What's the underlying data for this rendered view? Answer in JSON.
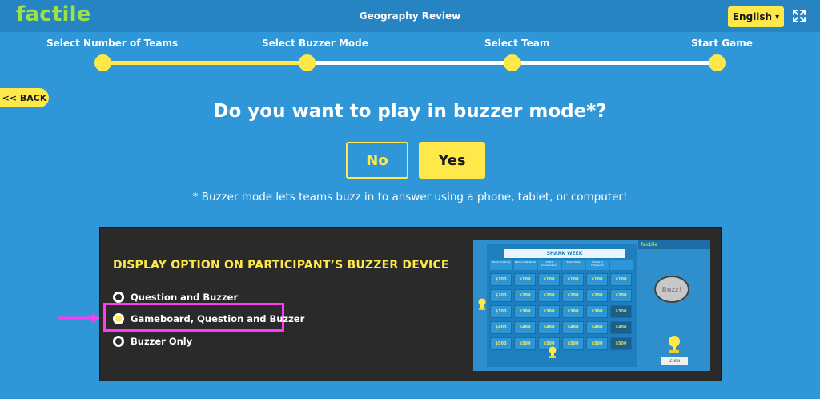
{
  "app": {
    "logo": "factile",
    "title": "Geography Review"
  },
  "header": {
    "language": "English",
    "language_chevron": "chevron-down-icon",
    "fullscreen_icon": "expand-icon"
  },
  "steps": [
    {
      "label": "Select Number of Teams",
      "state": "completed"
    },
    {
      "label": "Select Buzzer Mode",
      "state": "current"
    },
    {
      "label": "Select Team",
      "state": "upcoming"
    },
    {
      "label": "Start Game",
      "state": "upcoming"
    }
  ],
  "nav": {
    "back": "<< BACK"
  },
  "prompt": {
    "question": "Do you want to play in buzzer mode*?",
    "no": "No",
    "yes": "Yes",
    "note": "* Buzzer mode lets teams buzz in to answer using a phone, tablet, or computer!"
  },
  "display_options": {
    "heading": "DISPLAY OPTION ON PARTICIPANT’S BUZZER DEVICE",
    "selected": "Gameboard, Question and Buzzer",
    "options": [
      "Question and Buzzer",
      "Gameboard, Question and Buzzer",
      "Buzzer Only"
    ]
  },
  "preview": {
    "board_title": "SHARK WEEK",
    "categories": [
      "Shark Anatomy",
      "Name That Shark",
      "Shark Conservation",
      "Shark Facts",
      "Sharks in Hollywood",
      "..."
    ],
    "rows": [
      [
        "$100",
        "$100",
        "$100",
        "$100",
        "$100",
        "$100"
      ],
      [
        "$200",
        "$200",
        "$200",
        "$200",
        "$200",
        "$200"
      ],
      [
        "$300",
        "$300",
        "$300",
        "$300",
        "$300",
        "$300"
      ],
      [
        "$400",
        "$400",
        "$400",
        "$400",
        "$400",
        "$400"
      ],
      [
        "$500",
        "$500",
        "$500",
        "$500",
        "$500",
        "$500"
      ]
    ],
    "side_logo": "factile",
    "buzz": "Buzz!",
    "team": "LEMON"
  },
  "colors": {
    "accent": "#ffe84a",
    "background": "#2f97d7",
    "header": "#2684c2",
    "logo": "#9ee04a",
    "highlight": "#ff3bf2",
    "panel": "#2a2a2a"
  }
}
